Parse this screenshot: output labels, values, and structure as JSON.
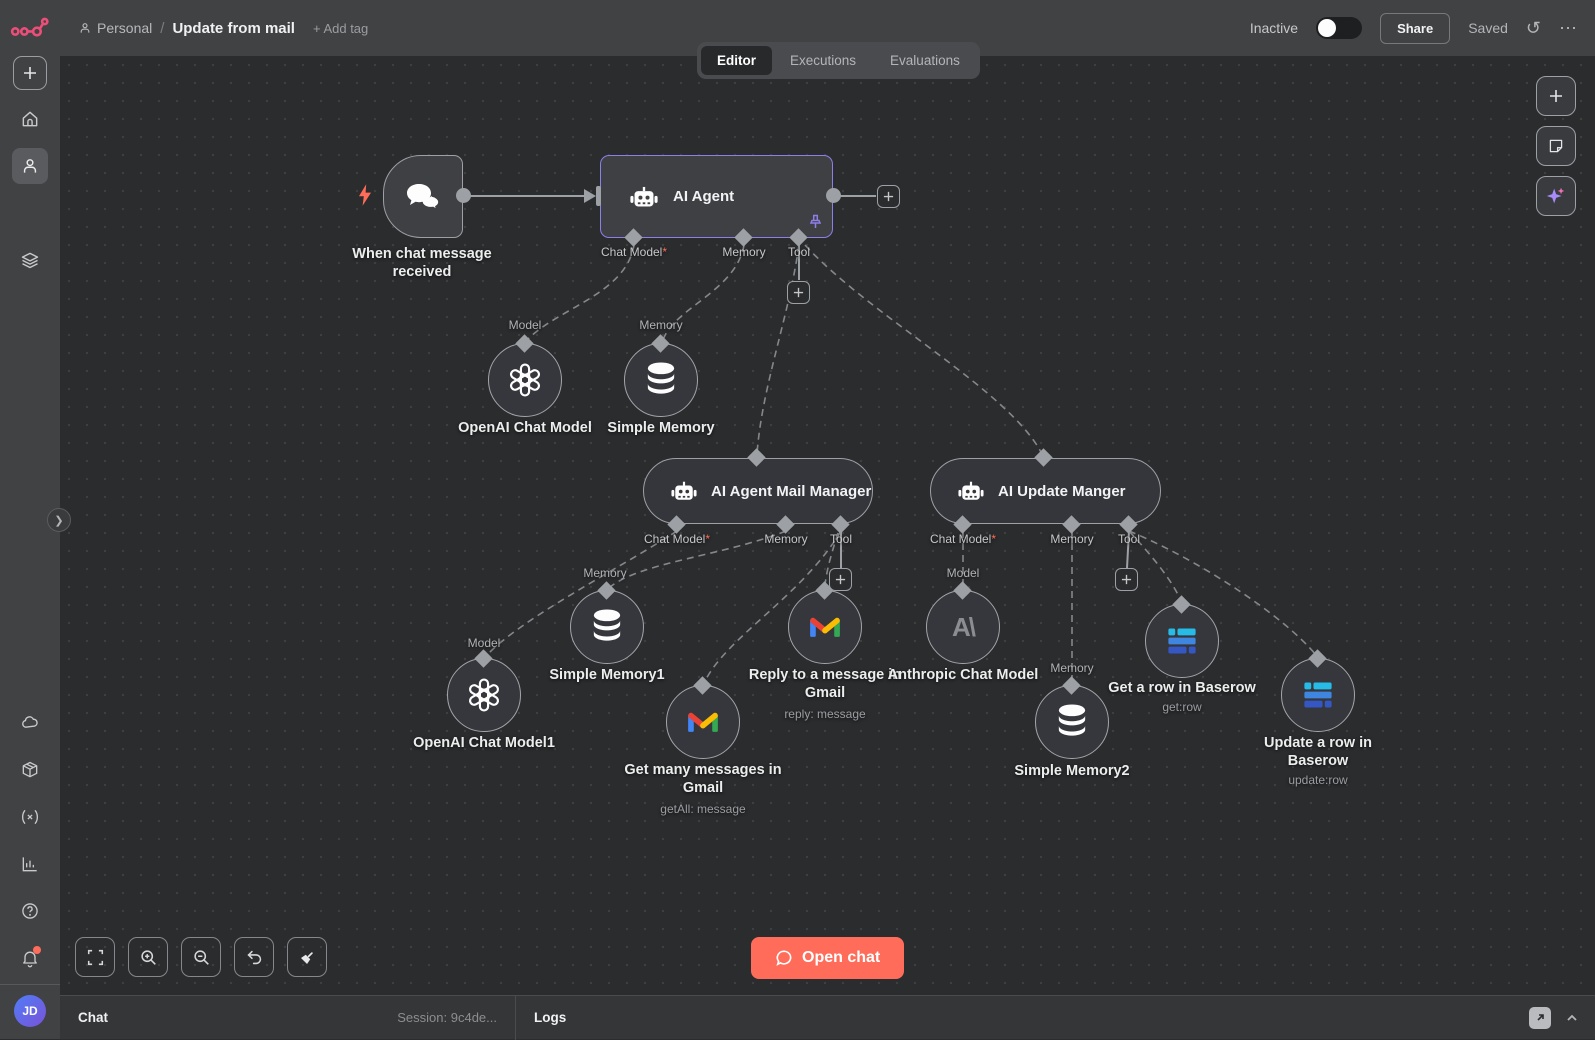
{
  "colors": {
    "accent": "#ff6d5a",
    "brand_logo": "#ed4e79",
    "selected_node_border": "#8d7fe8",
    "required_marker_color": "#ff6d5a",
    "canvas_bg": "#2b2c2e",
    "chrome_bg": "#414244"
  },
  "header": {
    "project": "Personal",
    "separator": "/",
    "title": "Update from mail",
    "add_tag": "+ Add tag",
    "status": "Inactive",
    "share": "Share",
    "saved": "Saved"
  },
  "tabs": {
    "editor": "Editor",
    "executions": "Executions",
    "evaluations": "Evaluations"
  },
  "sidebar": {
    "avatar_initials": "JD"
  },
  "icons": {
    "logo": "n8n-logo",
    "history": "history-icon",
    "more": "ellipsis-icon",
    "sidebar": [
      "plus-icon",
      "home-icon",
      "user-icon",
      "layers-icon",
      "cloud-icon",
      "package-icon",
      "variables-icon",
      "insights-icon",
      "help-icon",
      "bell-icon"
    ],
    "canvas_controls": [
      "fit-view-icon",
      "zoom-in-icon",
      "zoom-out-icon",
      "undo-icon",
      "tidy-up-icon"
    ],
    "panel_right": [
      "add-node-icon",
      "sticky-note-icon",
      "ai-sparkle-icon"
    ]
  },
  "canvas": {
    "required_marker": "*",
    "nodes": {
      "trigger": {
        "label": "When chat message received"
      },
      "agent": {
        "label": "AI Agent",
        "ports": [
          "Chat Model",
          "Memory",
          "Tool"
        ]
      },
      "openai": {
        "label": "OpenAI Chat Model",
        "port": "Model"
      },
      "memory": {
        "label": "Simple Memory",
        "port": "Memory"
      },
      "mail_manager": {
        "label": "AI Agent Mail Manager",
        "ports": [
          "Chat Model",
          "Memory",
          "Tool"
        ]
      },
      "update_manager": {
        "label": "AI Update Manger",
        "ports": [
          "Chat Model",
          "Memory",
          "Tool"
        ]
      },
      "openai1": {
        "label": "OpenAI Chat Model1",
        "port": "Model"
      },
      "simple_memory1": {
        "label": "Simple Memory1",
        "port": "Memory"
      },
      "gmail_get": {
        "label": "Get many messages in Gmail",
        "subtitle": "getAll: message"
      },
      "gmail_reply": {
        "label": "Reply to a message in Gmail",
        "subtitle": "reply: message"
      },
      "anthropic": {
        "label": "Anthropic Chat Model",
        "port": "Model"
      },
      "simple_memory2": {
        "label": "Simple Memory2",
        "port": "Memory"
      },
      "baserow_get": {
        "label": "Get a row in Baserow",
        "subtitle": "get:row"
      },
      "baserow_update": {
        "label": "Update a row in Baserow",
        "subtitle": "update:row"
      }
    },
    "open_chat": "Open chat"
  },
  "footer": {
    "chat": "Chat",
    "session": "Session: 9c4de...",
    "logs": "Logs"
  }
}
